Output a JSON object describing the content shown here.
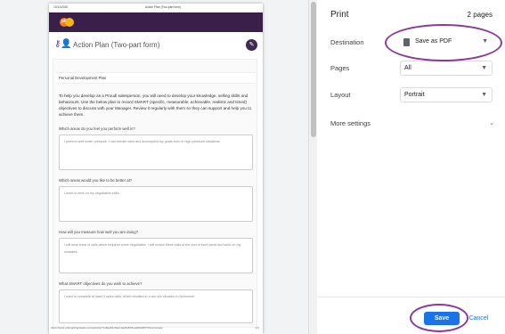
{
  "preview": {
    "header_date": "10/11/2020",
    "header_title": "Action Plan (Two-part form)",
    "logo_text": "pt",
    "page_title": "Action Plan (Two-part form)",
    "section_title": "Personal Development Plan",
    "intro": "To help you develop as a Proudl salesperson, you will need to develop your knowledge, selling skills and behaviours. Use the below plan to record SMART (specific, measurable, achievable, realistic and timed) objectives to discuss with your Manager. Review it regularly with them so they can support and help you to achieve them.",
    "questions": [
      {
        "label": "Which areas do you feel you perform well in?",
        "answer": "I perform well under pressure. I can remain calm and accomplish my goals even in high-pressure situations."
      },
      {
        "label": "Which areas would you like to be better at?",
        "answer": "I want to work on my negotiation skills."
      },
      {
        "label": "How will you measure how well you are doing?",
        "answer": "I will keep track of calls which required some negotiation. I will review these calls at the end of each week and work on my mistakes."
      },
      {
        "label": "What SMART objectives do you wish to achieve?",
        "answer": "I want to complete at least 3 sales calls, which resulted in a win-win situation in November"
      }
    ],
    "footer_url": "https://tests.onboarding4sales.com/activity/7cc8ea64-94e2-4ad6-8f36-ad0f104577/form/review",
    "footer_page": "1/2"
  },
  "panel": {
    "title": "Print",
    "pages_count": "2 pages",
    "destination_label": "Destination",
    "destination_value": "Save as PDF",
    "pages_label": "Pages",
    "pages_value": "All",
    "layout_label": "Layout",
    "layout_value": "Portrait",
    "more_settings": "More settings",
    "save_label": "Save",
    "cancel_label": "Cancel"
  },
  "colors": {
    "accent": "#1a73e8",
    "annotation": "#8b3a9c",
    "brand_band": "#3a1f4a"
  }
}
